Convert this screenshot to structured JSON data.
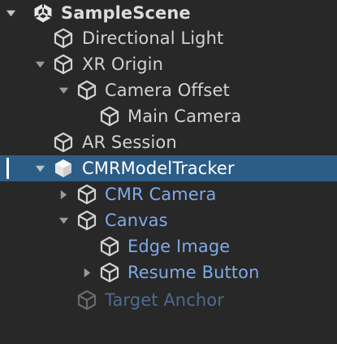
{
  "scene": {
    "name": "SampleScene",
    "icon": "unity-logo-icon"
  },
  "colors": {
    "background": "#282828",
    "selected_row": "#2c5d87",
    "text": "#d2d2d2",
    "prefab_text": "#7fa9e8",
    "prefab_inactive_text": "#4f6a93"
  },
  "hierarchy": [
    {
      "label": "Directional Light",
      "icon": "gameobject-cube-icon",
      "expanded": null,
      "style": "normal"
    },
    {
      "label": "XR Origin",
      "icon": "gameobject-cube-icon",
      "expanded": true,
      "style": "normal"
    },
    {
      "label": "Camera Offset",
      "icon": "gameobject-cube-icon",
      "expanded": true,
      "style": "normal"
    },
    {
      "label": "Main Camera",
      "icon": "gameobject-cube-icon",
      "expanded": null,
      "style": "normal"
    },
    {
      "label": "AR Session",
      "icon": "gameobject-cube-icon",
      "expanded": null,
      "style": "normal"
    },
    {
      "label": "CMRModelTracker",
      "icon": "prefab-cube-icon",
      "expanded": true,
      "style": "selected"
    },
    {
      "label": "CMR Camera",
      "icon": "prefab-cube-icon",
      "expanded": false,
      "style": "prefab"
    },
    {
      "label": "Canvas",
      "icon": "prefab-cube-icon",
      "expanded": true,
      "style": "prefab"
    },
    {
      "label": "Edge Image",
      "icon": "prefab-cube-icon",
      "expanded": null,
      "style": "prefab"
    },
    {
      "label": "Resume Button",
      "icon": "prefab-cube-icon",
      "expanded": false,
      "style": "prefab"
    },
    {
      "label": "Target Anchor",
      "icon": "prefab-cube-icon",
      "expanded": null,
      "style": "prefab-inactive"
    }
  ]
}
